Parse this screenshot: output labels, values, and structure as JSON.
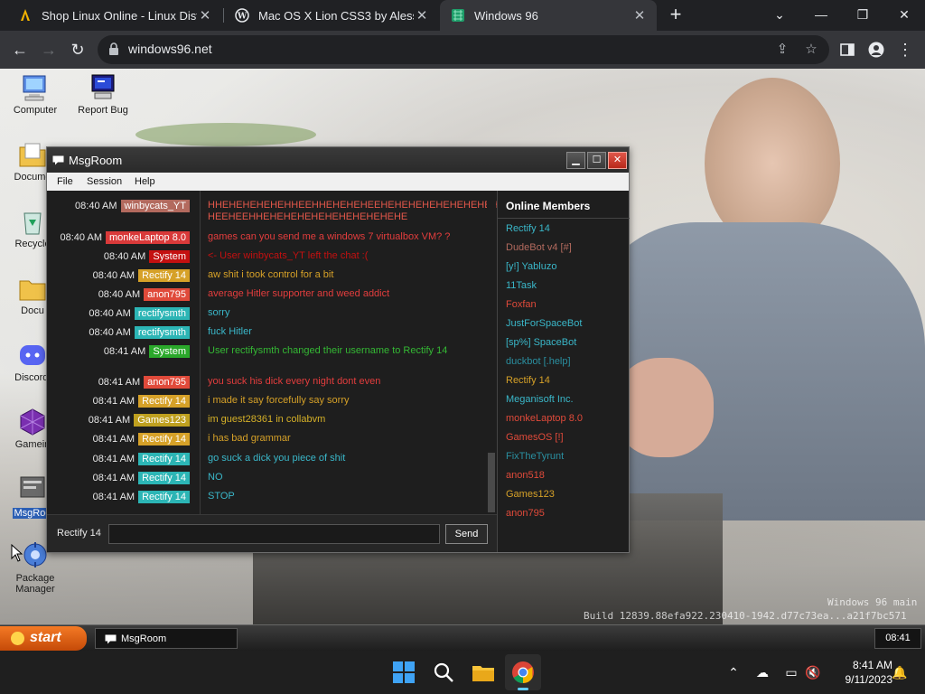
{
  "browser": {
    "tabs": [
      {
        "title": "Shop Linux Online - Linux Distros",
        "icon": "fire-icon",
        "active": false
      },
      {
        "title": "Mac OS X Lion CSS3 by Alessio A",
        "icon": "wordpress-icon",
        "active": false
      },
      {
        "title": "Windows 96",
        "icon": "windows96-icon",
        "active": true
      }
    ],
    "url": "windows96.net",
    "new_tab": "+"
  },
  "desktop": {
    "icons": [
      {
        "label": "Computer",
        "icon": "computer-icon"
      },
      {
        "label": "Report Bug",
        "icon": "report-bug-icon"
      },
      {
        "label": "Docume",
        "icon": "documents-folder-icon"
      },
      {
        "label": "Recycle",
        "icon": "recycle-bin-icon"
      },
      {
        "label": "Docu",
        "icon": "folder-icon"
      },
      {
        "label": "Discordi",
        "icon": "discord-icon"
      },
      {
        "label": "Gamein",
        "icon": "game-icon"
      },
      {
        "label": "MsgRoo",
        "icon": "msgroom-icon"
      },
      {
        "label": "Package Manager",
        "icon": "package-manager-icon"
      }
    ],
    "watermark": {
      "line1": "Windows 96 main",
      "line2": "Build 12839.88efa922.230410-1942.d77c73ea...a21f7bc571"
    }
  },
  "msgroom": {
    "title": "MsgRoom",
    "menu": [
      "File",
      "Session",
      "Help"
    ],
    "messages": [
      {
        "time": "08:40 AM",
        "user": "winbycats_YT",
        "user_color": "#b36a5e",
        "text": "HHEHEHEHEHEHHEEHHEHEHEHEEHEHEHEHEHEHEHEHEHE HEEHEEHHEHEHEHEHEHEHEHEHEHEHE",
        "text_color": "#e3574a"
      },
      {
        "time": "08:40 AM",
        "user": "monkeLaptop 8.0",
        "user_color": "#d93a3a",
        "text": "games can you send me a windows 7 virtualbox VM? ?",
        "text_color": "#e33d3d"
      },
      {
        "time": "08:40 AM",
        "user": "System",
        "user_color": "#c41010",
        "text": "<- User winbycats_YT left the chat :(",
        "text_color": "#c41010"
      },
      {
        "time": "08:40 AM",
        "user": "Rectify 14",
        "user_color": "#d6a128",
        "text": "aw shit i took control for a bit",
        "text_color": "#d6a128"
      },
      {
        "time": "08:40 AM",
        "user": "anon795",
        "user_color": "#e04a3a",
        "text": "average Hitler supporter and weed addict",
        "text_color": "#e33d3d"
      },
      {
        "time": "08:40 AM",
        "user": "rectifysmth",
        "user_color": "#2cb5b5",
        "text": "sorry",
        "text_color": "#3ab7c9"
      },
      {
        "time": "08:40 AM",
        "user": "rectifysmth",
        "user_color": "#2cb5b5",
        "text": "fuck Hitler",
        "text_color": "#3ab7c9"
      },
      {
        "time": "08:41 AM",
        "user": "System",
        "user_color": "#2aa82a",
        "text": "User rectifysmth changed their username to Rectify 14",
        "text_color": "#34b834"
      },
      {
        "time": "08:41 AM",
        "user": "anon795",
        "user_color": "#e04a3a",
        "text": "you suck his dick every night dont even",
        "text_color": "#e33d3d"
      },
      {
        "time": "08:41 AM",
        "user": "Rectify 14",
        "user_color": "#d6a128",
        "text": "i made it say forcefully say sorry",
        "text_color": "#d6a128"
      },
      {
        "time": "08:41 AM",
        "user": "Games123",
        "user_color": "#bfa01f",
        "text": "im guest28361 in collabvm",
        "text_color": "#d6b128"
      },
      {
        "time": "08:41 AM",
        "user": "Rectify 14",
        "user_color": "#d6a128",
        "text": "i has bad grammar",
        "text_color": "#d6a128"
      },
      {
        "time": "08:41 AM",
        "user": "Rectify 14",
        "user_color": "#2cb5b5",
        "text": "go suck a dick you piece of shit",
        "text_color": "#3ab7c9"
      },
      {
        "time": "08:41 AM",
        "user": "Rectify 14",
        "user_color": "#2cb5b5",
        "text": "NO",
        "text_color": "#3ab7c9"
      },
      {
        "time": "08:41 AM",
        "user": "Rectify 14",
        "user_color": "#2cb5b5",
        "text": "STOP",
        "text_color": "#3ab7c9"
      }
    ],
    "members_title": "Online Members",
    "members": [
      {
        "name": "Rectify 14",
        "color": "#3ab7c9"
      },
      {
        "name": "DudeBot v4 [#]",
        "color": "#b36a5e"
      },
      {
        "name": "[y!] Yabluzo",
        "color": "#3ab7c9"
      },
      {
        "name": "11Task",
        "color": "#3ab7c9"
      },
      {
        "name": "Foxfan",
        "color": "#e04a3a"
      },
      {
        "name": "JustForSpaceBot",
        "color": "#3ab7c9"
      },
      {
        "name": "[sp%] SpaceBot",
        "color": "#3ab7c9"
      },
      {
        "name": "duckbot [.help]",
        "color": "#2a8fa0"
      },
      {
        "name": "Rectify 14",
        "color": "#d6a128"
      },
      {
        "name": "Meganisoft Inc.",
        "color": "#3ab7c9"
      },
      {
        "name": "monkeLaptop 8.0",
        "color": "#e04a3a"
      },
      {
        "name": "GamesOS [!]",
        "color": "#e04a3a"
      },
      {
        "name": "FixTheTyrunt",
        "color": "#2a8fa0"
      },
      {
        "name": "anon518",
        "color": "#e04a3a"
      },
      {
        "name": "Games123",
        "color": "#d6a128"
      },
      {
        "name": "anon795",
        "color": "#e04a3a"
      }
    ],
    "input": {
      "nick": "Rectify 14",
      "value": "",
      "send_label": "Send"
    }
  },
  "w96_taskbar": {
    "start_label": "start",
    "task_label": "MsgRoom",
    "clock": "08:41"
  },
  "w11_taskbar": {
    "time": "8:41 AM",
    "date": "9/11/2023"
  }
}
